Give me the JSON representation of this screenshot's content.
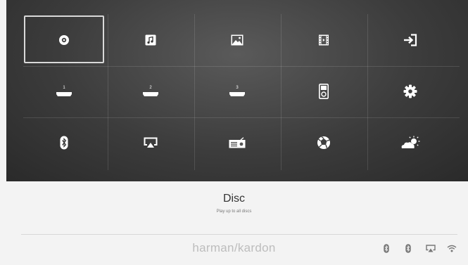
{
  "menu": {
    "selected_index": 0,
    "items": [
      {
        "id": "disc",
        "icon": "disc-icon"
      },
      {
        "id": "music",
        "icon": "music-note-icon"
      },
      {
        "id": "photo",
        "icon": "photo-icon"
      },
      {
        "id": "video",
        "icon": "film-icon"
      },
      {
        "id": "input",
        "icon": "input-arrow-icon"
      },
      {
        "id": "hdmi-1",
        "icon": "hdmi-input-icon",
        "badge": "1"
      },
      {
        "id": "hdmi-2",
        "icon": "hdmi-input-icon",
        "badge": "2"
      },
      {
        "id": "hdmi-3",
        "icon": "hdmi-input-icon",
        "badge": "3"
      },
      {
        "id": "ipod",
        "icon": "ipod-icon"
      },
      {
        "id": "settings",
        "icon": "gear-icon"
      },
      {
        "id": "bluetooth",
        "icon": "bluetooth-icon"
      },
      {
        "id": "airplay",
        "icon": "airplay-icon"
      },
      {
        "id": "radio",
        "icon": "radio-icon"
      },
      {
        "id": "photo-share",
        "icon": "aperture-icon"
      },
      {
        "id": "weather",
        "icon": "weather-icon"
      }
    ]
  },
  "info": {
    "title": "Disc",
    "subtitle": "Play up to all discs"
  },
  "footer": {
    "brand": "harman/kardon",
    "status_icons": [
      "bluetooth-icon",
      "bluetooth-icon",
      "airplay-icon",
      "wifi-icon"
    ]
  },
  "colors": {
    "panel_dark": "#3c3c3c",
    "selection_border": "#d9d9d9",
    "brand_text": "#bdbdbd"
  }
}
